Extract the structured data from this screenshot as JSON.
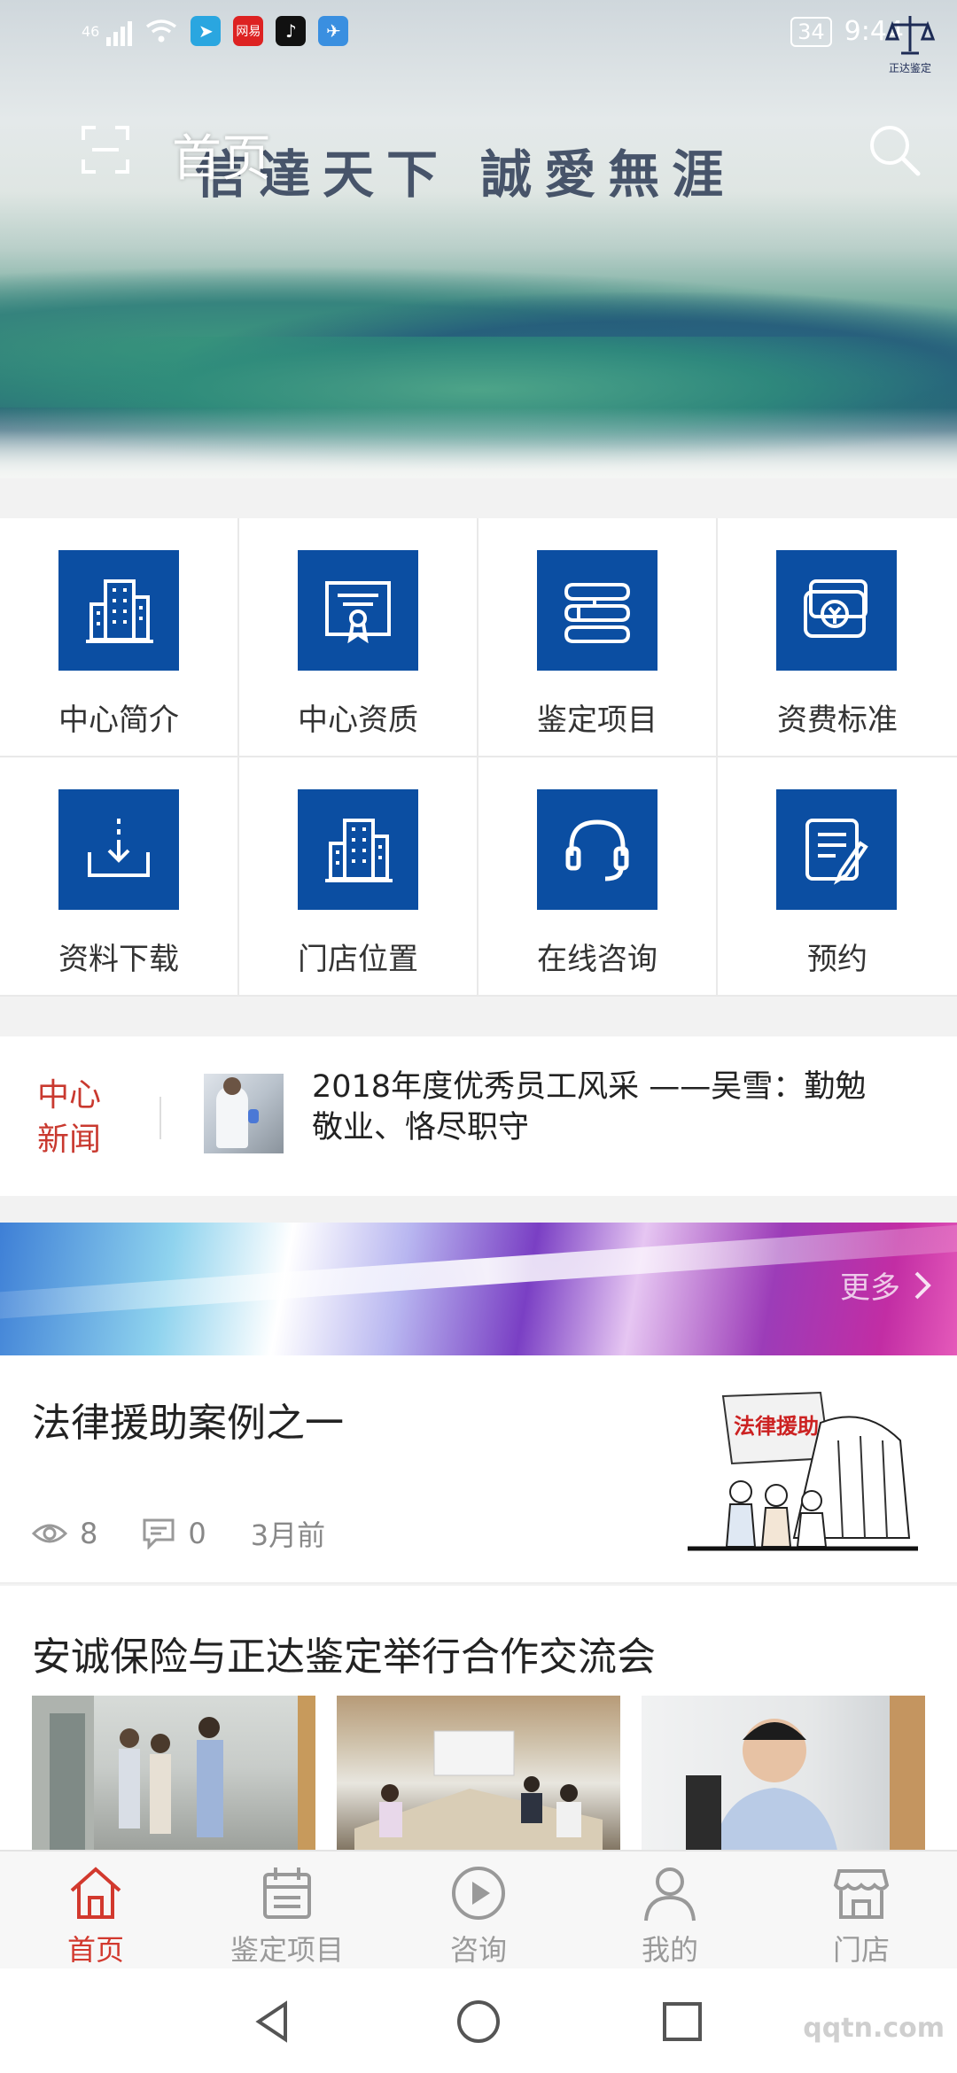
{
  "status_bar": {
    "network": "46",
    "app_badges": [
      "网易"
    ],
    "battery": "34",
    "time": "9:44"
  },
  "header": {
    "title": "首页",
    "banner_calligraphy": "信達天下 誠愛無涯",
    "corner_logo_text": "正达鉴定"
  },
  "grid": {
    "items": [
      {
        "label": "中心简介",
        "icon": "building-icon"
      },
      {
        "label": "中心资质",
        "icon": "certificate-icon"
      },
      {
        "label": "鉴定项目",
        "icon": "books-icon"
      },
      {
        "label": "资费标准",
        "icon": "money-cards-icon"
      },
      {
        "label": "资料下载",
        "icon": "download-icon"
      },
      {
        "label": "门店位置",
        "icon": "building-icon"
      },
      {
        "label": "在线咨询",
        "icon": "headset-icon"
      },
      {
        "label": "预约",
        "icon": "edit-document-icon"
      }
    ],
    "tile_color": "#0b4ea2"
  },
  "news": {
    "tag_line1": "中心",
    "tag_line2": "新闻",
    "headline": "2018年度优秀员工风采 ——吴雪：勤勉敬业、恪尽职守",
    "tag_color": "#c9392f"
  },
  "banner": {
    "more_label": "更多"
  },
  "articles": [
    {
      "title": "法律援助案例之一",
      "views": "8",
      "comments": "0",
      "time": "3月前",
      "image_text": "法律援助"
    },
    {
      "title": "安诚保险与正达鉴定举行合作交流会"
    }
  ],
  "tabs": [
    {
      "label": "首页",
      "icon": "home-icon",
      "active": true
    },
    {
      "label": "鉴定项目",
      "icon": "calendar-icon",
      "active": false
    },
    {
      "label": "咨询",
      "icon": "play-circle-icon",
      "active": false
    },
    {
      "label": "我的",
      "icon": "user-icon",
      "active": false
    },
    {
      "label": "门店",
      "icon": "store-icon",
      "active": false
    }
  ],
  "watermark": "qqtn.com",
  "accent_color": "#d2392e"
}
